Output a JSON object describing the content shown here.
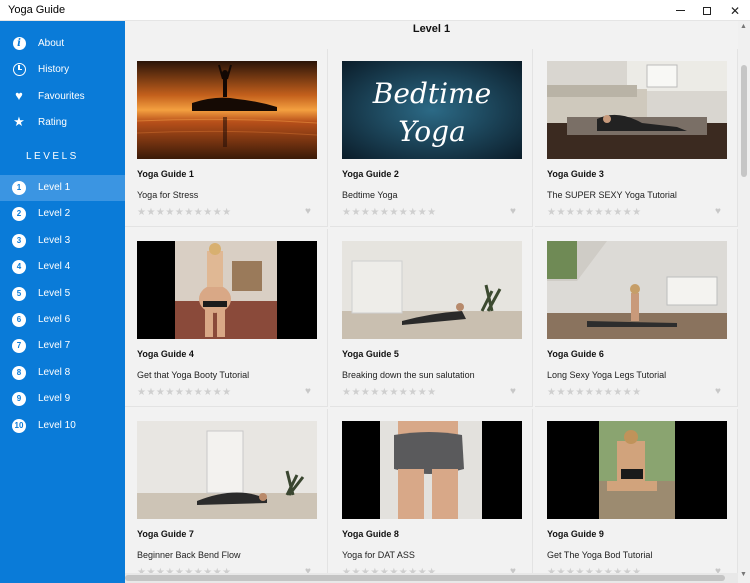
{
  "window": {
    "title": "Yoga Guide",
    "minimize_glyph": "",
    "maximize_glyph": "",
    "close_glyph": "✕"
  },
  "sidebar": {
    "items": [
      {
        "label": "About",
        "icon": "info-icon"
      },
      {
        "label": "History",
        "icon": "clock-icon"
      },
      {
        "label": "Favourites",
        "icon": "heart-icon"
      },
      {
        "label": "Rating",
        "icon": "star-icon"
      }
    ],
    "levels_header": "LEVELS",
    "levels": [
      {
        "num": "1",
        "label": "Level 1",
        "selected": true
      },
      {
        "num": "2",
        "label": "Level 2"
      },
      {
        "num": "3",
        "label": "Level 3"
      },
      {
        "num": "4",
        "label": "Level 4"
      },
      {
        "num": "5",
        "label": "Level 5"
      },
      {
        "num": "6",
        "label": "Level 6"
      },
      {
        "num": "7",
        "label": "Level 7"
      },
      {
        "num": "8",
        "label": "Level 8"
      },
      {
        "num": "9",
        "label": "Level 9"
      },
      {
        "num": "10",
        "label": "Level 10"
      }
    ],
    "accent_color": "#0a7bd8",
    "selected_color": "#3b95e2"
  },
  "main": {
    "title": "Level 1",
    "cards": [
      {
        "title": "Yoga Guide 1",
        "subtitle": "Yoga for Stress",
        "stars": "★★★★★★★★★★",
        "thumb": "sunset-meditation"
      },
      {
        "title": "Yoga Guide 2",
        "subtitle": "Bedtime Yoga",
        "stars": "★★★★★★★★★★",
        "thumb": "bedtime-yoga-text",
        "thumb_text_1": "Bedtime",
        "thumb_text_2": "Yoga"
      },
      {
        "title": "Yoga Guide 3",
        "subtitle": "The SUPER SEXY Yoga Tutorial",
        "stars": "★★★★★★★★★★",
        "thumb": "living-room-stretch"
      },
      {
        "title": "Yoga Guide 4",
        "subtitle": "Get that Yoga Booty Tutorial",
        "stars": "★★★★★★★★★★",
        "thumb": "booty-mirror"
      },
      {
        "title": "Yoga Guide 5",
        "subtitle": "Breaking down the sun salutation",
        "stars": "★★★★★★★★★★",
        "thumb": "floor-stretch"
      },
      {
        "title": "Yoga Guide 6",
        "subtitle": "Long Sexy Yoga Legs Tutorial",
        "stars": "★★★★★★★★★★",
        "thumb": "bedroom-splits"
      },
      {
        "title": "Yoga Guide 7",
        "subtitle": "Beginner Back Bend Flow",
        "stars": "★★★★★★★★★★",
        "thumb": "backbend-room"
      },
      {
        "title": "Yoga Guide 8",
        "subtitle": "Yoga for DAT ASS",
        "stars": "★★★★★★★★★★",
        "thumb": "shorts-closeup"
      },
      {
        "title": "Yoga Guide 9",
        "subtitle": "Get The Yoga Bod Tutorial",
        "stars": "★★★★★★★★★★",
        "thumb": "garden-pose"
      }
    ],
    "heart_glyph": "♥"
  }
}
